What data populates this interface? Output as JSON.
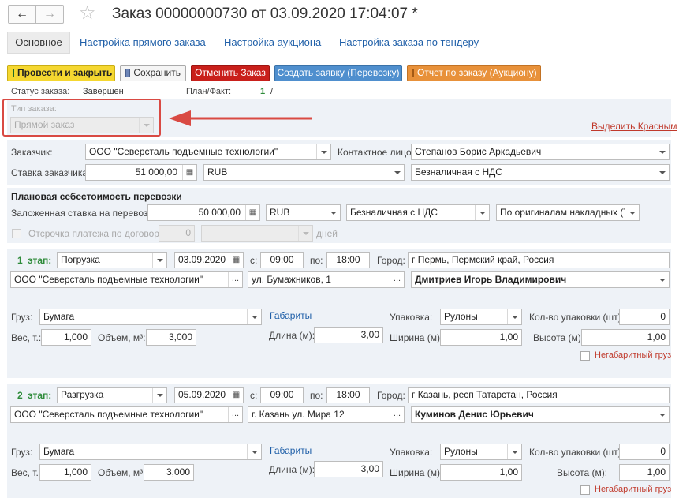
{
  "window": {
    "title": "Заказ 00000000730 от 03.09.2020 17:04:07 *"
  },
  "tabs": [
    {
      "label": "Основное"
    },
    {
      "label": "Настройка прямого заказа"
    },
    {
      "label": "Настройка аукциона"
    },
    {
      "label": "Настройка заказа по тендеру"
    }
  ],
  "toolbar": {
    "post_close": "Провести и закрыть",
    "save": "Сохранить",
    "cancel_order": "Отменить Заказ",
    "create_request": "Создать заявку (Перевозку)",
    "auction_report": "Отчет по заказу (Аукциону)",
    "colors": {
      "post": "#f5d730",
      "cancel": "#c9201b",
      "create": "#4f8fce",
      "report": "#e8913a"
    }
  },
  "status": {
    "label": "Статус заказа:",
    "value": "Завершен",
    "plan_fact_label": "План/Факт:",
    "plan": "1",
    "slash": "/"
  },
  "order_type": {
    "label": "Тип заказа:",
    "value": "Прямой заказ"
  },
  "highlight_link": "Выделить Красным",
  "customer": {
    "label": "Заказчик:",
    "value": "ООО \"Северсталь подъемные технологии\"",
    "contact_label": "Контактное лицо:",
    "contact": "Степанов Борис Аркадьевич",
    "rate_label": "Ставка заказчика:",
    "rate": "51 000,00",
    "currency": "RUB",
    "payment": "Безналичная с НДС"
  },
  "planned_cost": {
    "heading": "Плановая себестоимость перевозки",
    "rate_label": "Заложенная ставка на перевозку:",
    "rate": "50 000,00",
    "currency": "RUB",
    "payment": "Безналичная с НДС",
    "docs": "По оригиналам накладных (ТН",
    "deferral_label": "Отсрочка платежа по договору:",
    "deferral": "0",
    "days": "дней"
  },
  "stage_labels": {
    "stage": "этап:",
    "from": "с:",
    "to": "по:",
    "city": "Город:",
    "cargo": "Груз:",
    "weight": "Вес, т.:",
    "volume": "Объем, м³:",
    "dims_link": "Габариты",
    "length": "Длина (м):",
    "packing": "Упаковка:",
    "pack_count": "Кол-во упаковки (шт):",
    "width": "Ширина (м):",
    "height": "Высота (м):",
    "oversize": "Негабаритный груз"
  },
  "stages": [
    {
      "num": "1",
      "type": "Погрузка",
      "date": "03.09.2020",
      "time_from": "09:00",
      "time_to": "18:00",
      "city": "г Пермь,  Пермский край, Россия",
      "org": "ООО \"Северсталь подъемные технологии\"",
      "address": "ул. Бумажников, 1",
      "contact": "Дмитриев Игорь Владимирович",
      "cargo": "Бумага",
      "weight": "1,000",
      "volume": "3,000",
      "length": "3,00",
      "packing": "Рулоны",
      "pack_count": "0",
      "width": "1,00",
      "height": "1,00"
    },
    {
      "num": "2",
      "type": "Разгрузка",
      "date": "05.09.2020",
      "time_from": "09:00",
      "time_to": "18:00",
      "city": "г Казань,  респ Татарстан, Россия",
      "org": "ООО \"Северсталь подъемные технологии\"",
      "address": "г. Казань ул. Мира 12",
      "contact": "Куминов Денис Юрьевич",
      "cargo": "Бумага",
      "weight": "1,000",
      "volume": "3,000",
      "length": "3,00",
      "packing": "Рулоны",
      "pack_count": "0",
      "width": "1,00",
      "height": "1,00"
    }
  ]
}
